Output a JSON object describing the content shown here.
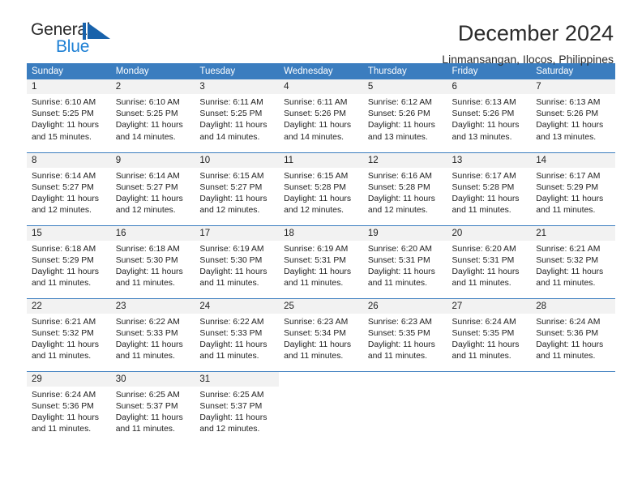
{
  "brand": {
    "name_part1": "General",
    "name_part2": "Blue",
    "mark_icon": "triangle-sail-logo",
    "blue": "#1c7fd4"
  },
  "header": {
    "title": "December 2024",
    "subtitle": "Linmansangan, Ilocos, Philippines"
  },
  "theme": {
    "header_blue": "#3b7dbf",
    "daynum_bg": "#f2f2f2"
  },
  "weekday_headers": [
    "Sunday",
    "Monday",
    "Tuesday",
    "Wednesday",
    "Thursday",
    "Friday",
    "Saturday"
  ],
  "weeks": [
    {
      "days": [
        {
          "daynum": "1",
          "sunrise": "Sunrise: 6:10 AM",
          "sunset": "Sunset: 5:25 PM",
          "daylight_1": "Daylight: 11 hours",
          "daylight_2": "and 15 minutes."
        },
        {
          "daynum": "2",
          "sunrise": "Sunrise: 6:10 AM",
          "sunset": "Sunset: 5:25 PM",
          "daylight_1": "Daylight: 11 hours",
          "daylight_2": "and 14 minutes."
        },
        {
          "daynum": "3",
          "sunrise": "Sunrise: 6:11 AM",
          "sunset": "Sunset: 5:25 PM",
          "daylight_1": "Daylight: 11 hours",
          "daylight_2": "and 14 minutes."
        },
        {
          "daynum": "4",
          "sunrise": "Sunrise: 6:11 AM",
          "sunset": "Sunset: 5:26 PM",
          "daylight_1": "Daylight: 11 hours",
          "daylight_2": "and 14 minutes."
        },
        {
          "daynum": "5",
          "sunrise": "Sunrise: 6:12 AM",
          "sunset": "Sunset: 5:26 PM",
          "daylight_1": "Daylight: 11 hours",
          "daylight_2": "and 13 minutes."
        },
        {
          "daynum": "6",
          "sunrise": "Sunrise: 6:13 AM",
          "sunset": "Sunset: 5:26 PM",
          "daylight_1": "Daylight: 11 hours",
          "daylight_2": "and 13 minutes."
        },
        {
          "daynum": "7",
          "sunrise": "Sunrise: 6:13 AM",
          "sunset": "Sunset: 5:26 PM",
          "daylight_1": "Daylight: 11 hours",
          "daylight_2": "and 13 minutes."
        }
      ]
    },
    {
      "days": [
        {
          "daynum": "8",
          "sunrise": "Sunrise: 6:14 AM",
          "sunset": "Sunset: 5:27 PM",
          "daylight_1": "Daylight: 11 hours",
          "daylight_2": "and 12 minutes."
        },
        {
          "daynum": "9",
          "sunrise": "Sunrise: 6:14 AM",
          "sunset": "Sunset: 5:27 PM",
          "daylight_1": "Daylight: 11 hours",
          "daylight_2": "and 12 minutes."
        },
        {
          "daynum": "10",
          "sunrise": "Sunrise: 6:15 AM",
          "sunset": "Sunset: 5:27 PM",
          "daylight_1": "Daylight: 11 hours",
          "daylight_2": "and 12 minutes."
        },
        {
          "daynum": "11",
          "sunrise": "Sunrise: 6:15 AM",
          "sunset": "Sunset: 5:28 PM",
          "daylight_1": "Daylight: 11 hours",
          "daylight_2": "and 12 minutes."
        },
        {
          "daynum": "12",
          "sunrise": "Sunrise: 6:16 AM",
          "sunset": "Sunset: 5:28 PM",
          "daylight_1": "Daylight: 11 hours",
          "daylight_2": "and 12 minutes."
        },
        {
          "daynum": "13",
          "sunrise": "Sunrise: 6:17 AM",
          "sunset": "Sunset: 5:28 PM",
          "daylight_1": "Daylight: 11 hours",
          "daylight_2": "and 11 minutes."
        },
        {
          "daynum": "14",
          "sunrise": "Sunrise: 6:17 AM",
          "sunset": "Sunset: 5:29 PM",
          "daylight_1": "Daylight: 11 hours",
          "daylight_2": "and 11 minutes."
        }
      ]
    },
    {
      "days": [
        {
          "daynum": "15",
          "sunrise": "Sunrise: 6:18 AM",
          "sunset": "Sunset: 5:29 PM",
          "daylight_1": "Daylight: 11 hours",
          "daylight_2": "and 11 minutes."
        },
        {
          "daynum": "16",
          "sunrise": "Sunrise: 6:18 AM",
          "sunset": "Sunset: 5:30 PM",
          "daylight_1": "Daylight: 11 hours",
          "daylight_2": "and 11 minutes."
        },
        {
          "daynum": "17",
          "sunrise": "Sunrise: 6:19 AM",
          "sunset": "Sunset: 5:30 PM",
          "daylight_1": "Daylight: 11 hours",
          "daylight_2": "and 11 minutes."
        },
        {
          "daynum": "18",
          "sunrise": "Sunrise: 6:19 AM",
          "sunset": "Sunset: 5:31 PM",
          "daylight_1": "Daylight: 11 hours",
          "daylight_2": "and 11 minutes."
        },
        {
          "daynum": "19",
          "sunrise": "Sunrise: 6:20 AM",
          "sunset": "Sunset: 5:31 PM",
          "daylight_1": "Daylight: 11 hours",
          "daylight_2": "and 11 minutes."
        },
        {
          "daynum": "20",
          "sunrise": "Sunrise: 6:20 AM",
          "sunset": "Sunset: 5:31 PM",
          "daylight_1": "Daylight: 11 hours",
          "daylight_2": "and 11 minutes."
        },
        {
          "daynum": "21",
          "sunrise": "Sunrise: 6:21 AM",
          "sunset": "Sunset: 5:32 PM",
          "daylight_1": "Daylight: 11 hours",
          "daylight_2": "and 11 minutes."
        }
      ]
    },
    {
      "days": [
        {
          "daynum": "22",
          "sunrise": "Sunrise: 6:21 AM",
          "sunset": "Sunset: 5:32 PM",
          "daylight_1": "Daylight: 11 hours",
          "daylight_2": "and 11 minutes."
        },
        {
          "daynum": "23",
          "sunrise": "Sunrise: 6:22 AM",
          "sunset": "Sunset: 5:33 PM",
          "daylight_1": "Daylight: 11 hours",
          "daylight_2": "and 11 minutes."
        },
        {
          "daynum": "24",
          "sunrise": "Sunrise: 6:22 AM",
          "sunset": "Sunset: 5:33 PM",
          "daylight_1": "Daylight: 11 hours",
          "daylight_2": "and 11 minutes."
        },
        {
          "daynum": "25",
          "sunrise": "Sunrise: 6:23 AM",
          "sunset": "Sunset: 5:34 PM",
          "daylight_1": "Daylight: 11 hours",
          "daylight_2": "and 11 minutes."
        },
        {
          "daynum": "26",
          "sunrise": "Sunrise: 6:23 AM",
          "sunset": "Sunset: 5:35 PM",
          "daylight_1": "Daylight: 11 hours",
          "daylight_2": "and 11 minutes."
        },
        {
          "daynum": "27",
          "sunrise": "Sunrise: 6:24 AM",
          "sunset": "Sunset: 5:35 PM",
          "daylight_1": "Daylight: 11 hours",
          "daylight_2": "and 11 minutes."
        },
        {
          "daynum": "28",
          "sunrise": "Sunrise: 6:24 AM",
          "sunset": "Sunset: 5:36 PM",
          "daylight_1": "Daylight: 11 hours",
          "daylight_2": "and 11 minutes."
        }
      ]
    },
    {
      "days": [
        {
          "daynum": "29",
          "sunrise": "Sunrise: 6:24 AM",
          "sunset": "Sunset: 5:36 PM",
          "daylight_1": "Daylight: 11 hours",
          "daylight_2": "and 11 minutes."
        },
        {
          "daynum": "30",
          "sunrise": "Sunrise: 6:25 AM",
          "sunset": "Sunset: 5:37 PM",
          "daylight_1": "Daylight: 11 hours",
          "daylight_2": "and 11 minutes."
        },
        {
          "daynum": "31",
          "sunrise": "Sunrise: 6:25 AM",
          "sunset": "Sunset: 5:37 PM",
          "daylight_1": "Daylight: 11 hours",
          "daylight_2": "and 12 minutes."
        },
        {
          "daynum": "",
          "sunrise": "",
          "sunset": "",
          "daylight_1": "",
          "daylight_2": ""
        },
        {
          "daynum": "",
          "sunrise": "",
          "sunset": "",
          "daylight_1": "",
          "daylight_2": ""
        },
        {
          "daynum": "",
          "sunrise": "",
          "sunset": "",
          "daylight_1": "",
          "daylight_2": ""
        },
        {
          "daynum": "",
          "sunrise": "",
          "sunset": "",
          "daylight_1": "",
          "daylight_2": ""
        }
      ]
    }
  ]
}
